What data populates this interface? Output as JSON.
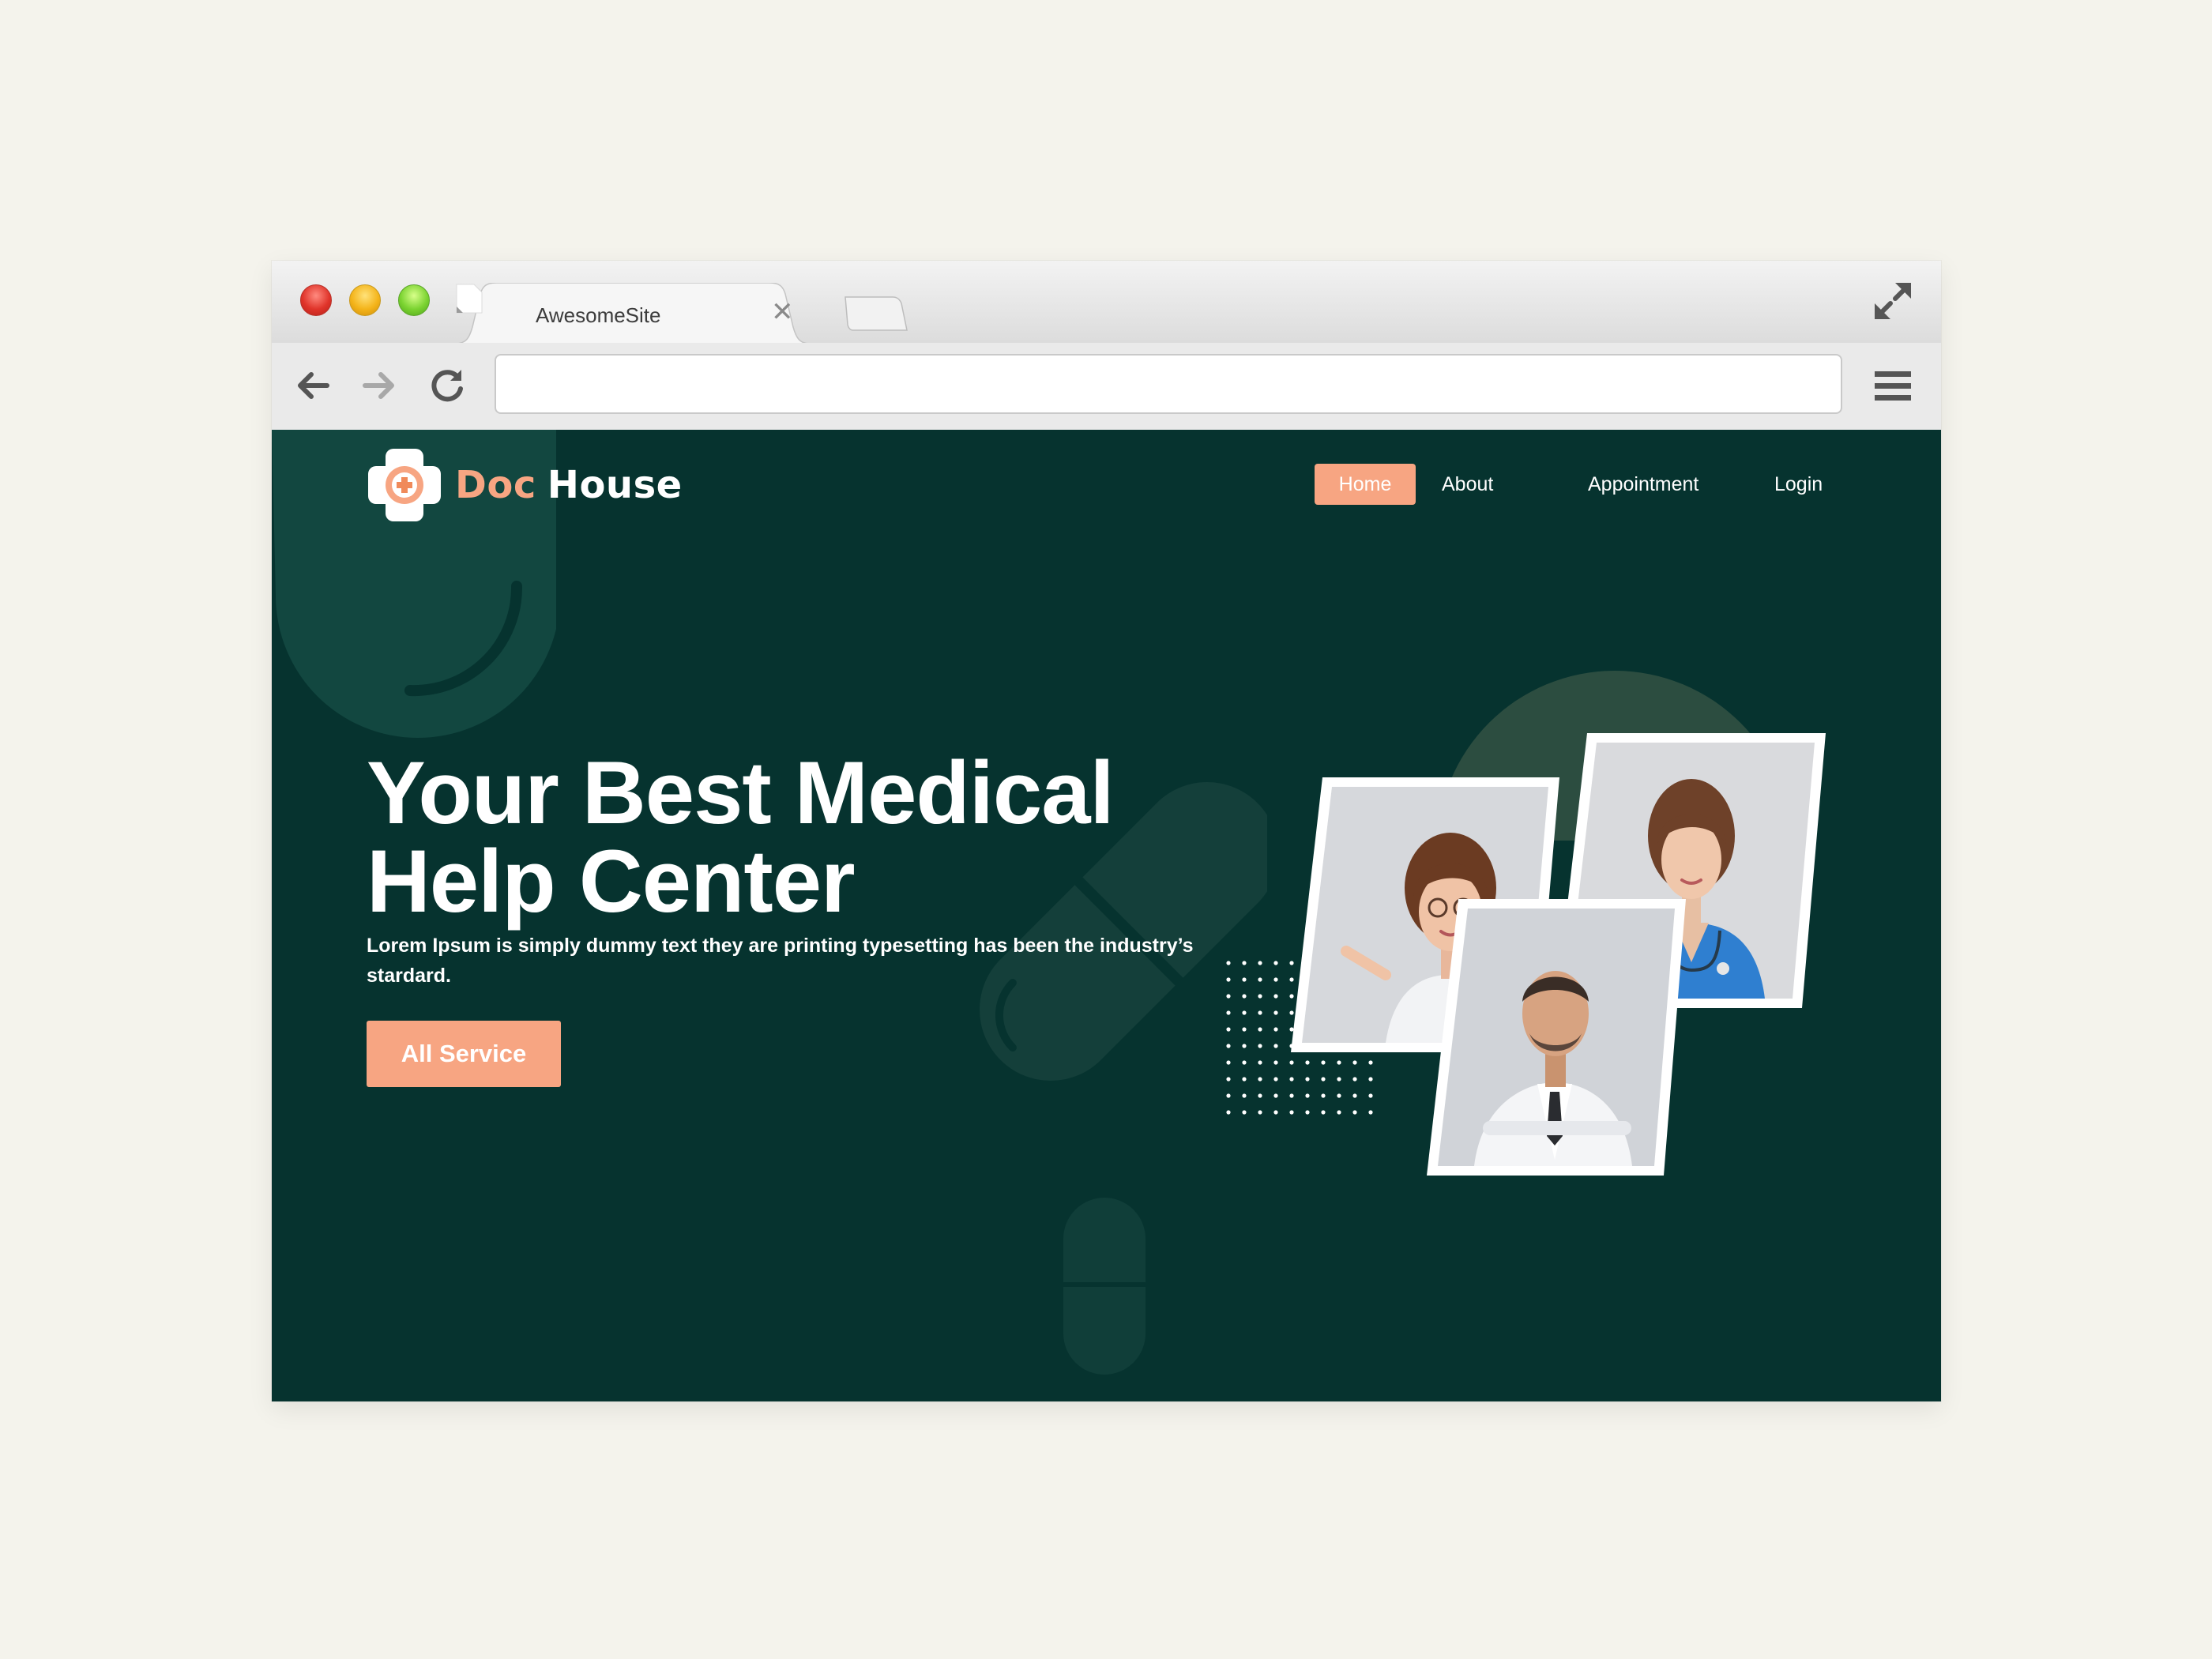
{
  "browser": {
    "tab_title": "AwesomeSite",
    "url_value": ""
  },
  "site": {
    "brand_primary": "Doc",
    "brand_secondary": "House",
    "nav": [
      {
        "label": "Home",
        "active": true
      },
      {
        "label": "About",
        "active": false
      },
      {
        "label": "Appointment",
        "active": false
      },
      {
        "label": "Login",
        "active": false
      }
    ]
  },
  "hero": {
    "title_line1": "Your Best Medical",
    "title_line2": "Help Center",
    "description": "Lorem Ipsum is simply dummy text they are printing typesetting has been the industry’s stardard.",
    "button_label": "All Service"
  },
  "colors": {
    "background": "#06332f",
    "accent": "#f7a582",
    "page_bg": "#f4f3ec"
  },
  "icons": [
    "close-icon",
    "back-arrow-icon",
    "forward-arrow-icon",
    "reload-icon",
    "fullscreen-icon",
    "hamburger-menu-icon",
    "medical-cross-logo-icon"
  ]
}
